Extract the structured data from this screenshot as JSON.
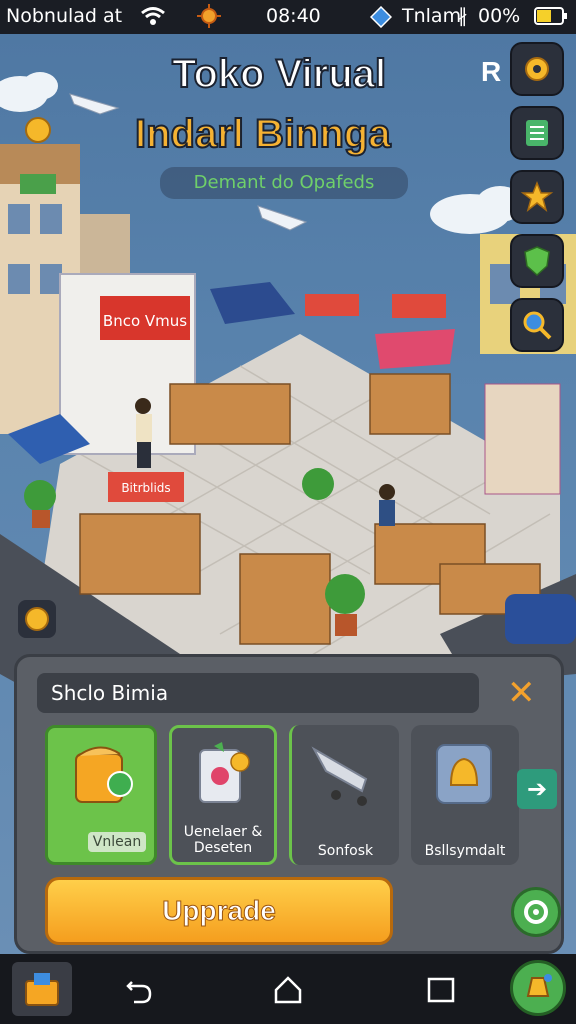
{
  "status_bar": {
    "left_text": "Nobnulad at",
    "time": "08:40",
    "right_text": "Tnlam",
    "battery": "00%"
  },
  "header": {
    "title_line1": "Toko Virual",
    "title_line2": "Indarl Binnga",
    "subtitle": "Demant do Opafeds",
    "side_letter": "R"
  },
  "side_buttons": [
    {
      "icon": "gear-icon"
    },
    {
      "icon": "list-icon"
    },
    {
      "icon": "star-icon"
    },
    {
      "icon": "shield-icon"
    },
    {
      "icon": "search-icon"
    }
  ],
  "panel": {
    "title": "Shclo Bimia",
    "close_symbol": "✕",
    "cards": [
      {
        "label": "Vnlean",
        "icon": "box-icon"
      },
      {
        "label": "Uenelaer & Deseten",
        "icon": "device-icon"
      },
      {
        "label": "Sonfosk",
        "icon": "cart-icon"
      },
      {
        "label": "Bsllsymdalt",
        "icon": "bell-icon"
      }
    ],
    "next_symbol": "➔",
    "upgrade_label": "Upprade"
  },
  "colors": {
    "accent_orange": "#f5a623",
    "panel_bg": "#5b5f66",
    "card_green": "#6cc34a",
    "sky_water": "#5a84ae"
  }
}
